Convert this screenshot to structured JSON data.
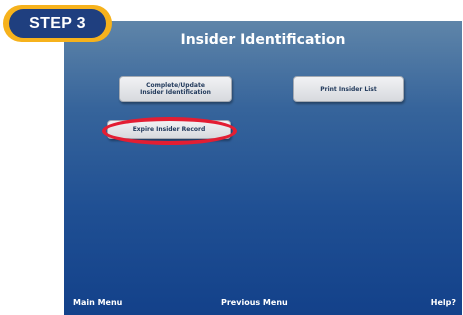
{
  "step_label": "STEP 3",
  "screen": {
    "title": "Insider Identification",
    "buttons": {
      "complete_line1": "Complete/Update",
      "complete_line2": "Insider Identification",
      "print": "Print Insider List",
      "expire": "Expire Insider Record"
    },
    "footer": {
      "main_menu": "Main Menu",
      "previous_menu": "Previous Menu",
      "help": "Help?"
    }
  },
  "colors": {
    "badge_outer": "#f6b21c",
    "badge_inner": "#1f3f7f",
    "highlight": "#e31e33",
    "screen_top": "#5f85a9",
    "screen_bottom": "#13418a"
  }
}
